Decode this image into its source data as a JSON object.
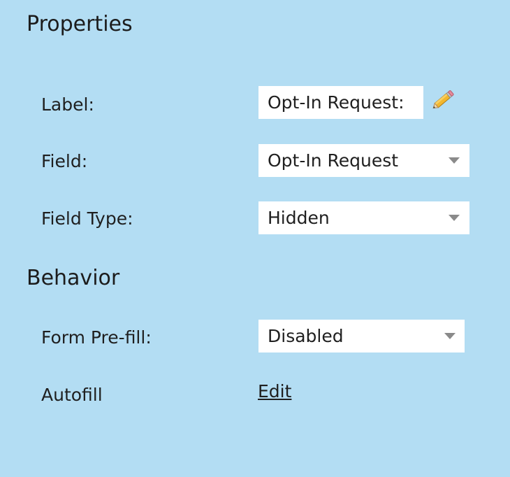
{
  "properties": {
    "title": "Properties",
    "label": {
      "label": "Label:",
      "value": "Opt-In Request:",
      "edit_icon": "pencil-icon"
    },
    "field": {
      "label": "Field:",
      "value": "Opt-In Request"
    },
    "field_type": {
      "label": "Field Type:",
      "value": "Hidden"
    }
  },
  "behavior": {
    "title": "Behavior",
    "form_prefill": {
      "label": "Form Pre-fill:",
      "value": "Disabled"
    },
    "autofill": {
      "label": "Autofill",
      "link": "Edit"
    }
  },
  "colors": {
    "background": "#b3ddf3",
    "input_background": "#ffffff",
    "caret": "#8a8a8a"
  }
}
